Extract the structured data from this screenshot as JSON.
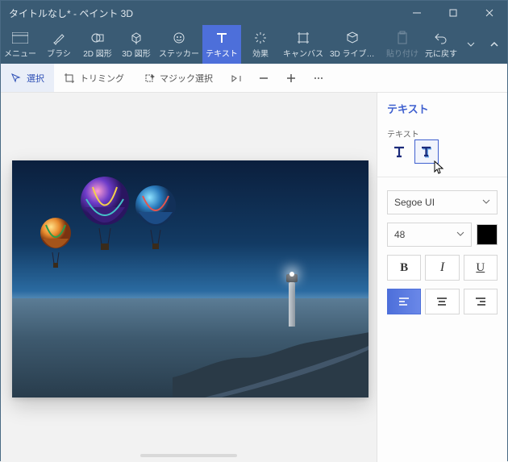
{
  "window": {
    "title": "タイトルなし* - ペイント 3D"
  },
  "ribbon": {
    "menu": "メニュー",
    "brush": "ブラシ",
    "shape2d": "2D 図形",
    "shape3d": "3D 図形",
    "sticker": "ステッカー",
    "text": "テキスト",
    "effects": "効果",
    "canvas": "キャンバス",
    "lib3d": "3D ライブ…",
    "paste": "貼り付け",
    "undo": "元に戻す"
  },
  "toolbar2": {
    "select": "選択",
    "crop": "トリミング",
    "magic": "マジック選択"
  },
  "panel": {
    "header": "テキスト",
    "sublabel": "テキスト",
    "font": "Segoe UI",
    "size": "48",
    "bold": "B",
    "italic": "I",
    "underline": "U",
    "color": "#000000"
  }
}
